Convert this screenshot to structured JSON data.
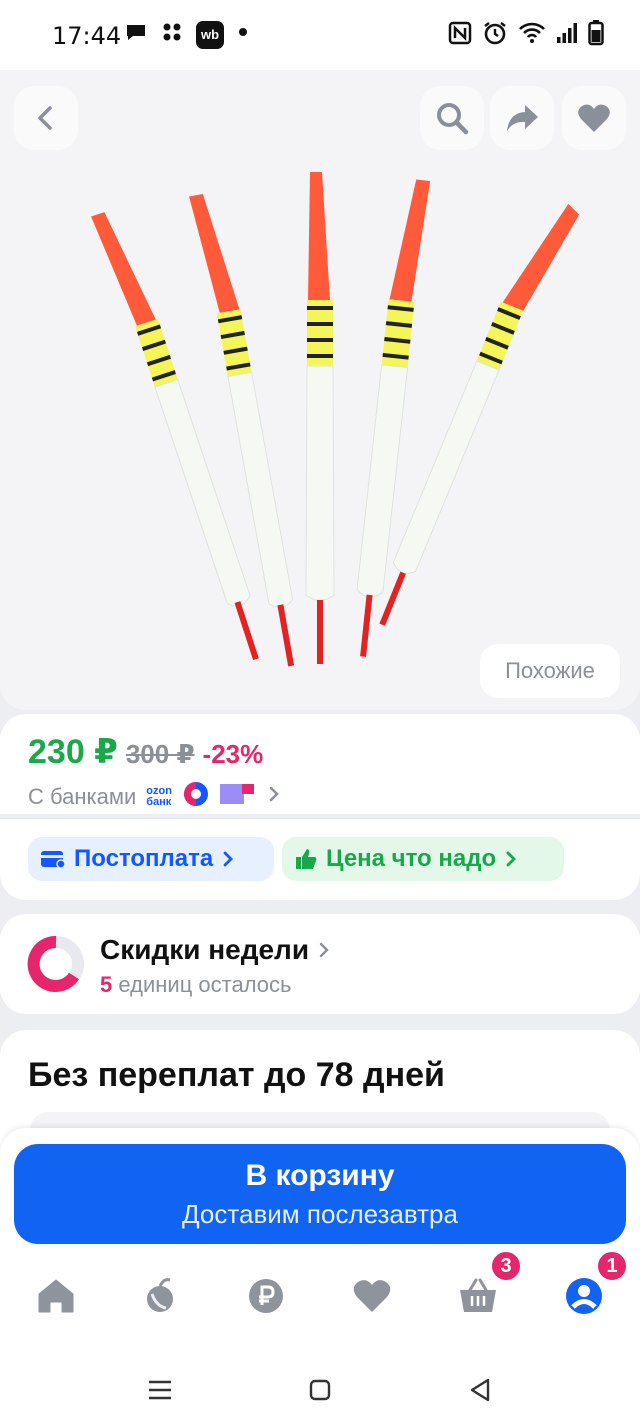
{
  "status_bar": {
    "time": "17:44",
    "left_icons": [
      "chat-bubble-icon",
      "apps-dots-icon",
      "wb-app-icon",
      "notification-dot-icon"
    ],
    "wb_logo_text": "wb",
    "right_icons": [
      "nfc-icon",
      "alarm-icon",
      "wifi-icon",
      "signal-icon",
      "battery-icon"
    ]
  },
  "product": {
    "image_desc_icon": "fishing-floats-image",
    "similar_label": "Похожие"
  },
  "price": {
    "current": "230 ₽",
    "old": "300 ₽",
    "discount": "-23%",
    "banks_label": "С банками",
    "ozon_bank_line1": "ozon",
    "ozon_bank_line2": "банк"
  },
  "payment_chips": {
    "postpay_label": "Постоплата",
    "price_label": "Цена что надо"
  },
  "weekly_discounts": {
    "title": "Скидки недели",
    "count": "5",
    "remaining_text": "единиц осталось"
  },
  "installment": {
    "title": "Без переплат до 78 дней"
  },
  "cart_button": {
    "title": "В корзину",
    "subtitle": "Доставим послезавтра"
  },
  "bottom_nav": {
    "items": [
      "home-icon",
      "catalog-icon",
      "ruble-icon",
      "favorites-icon",
      "cart-icon",
      "profile-icon"
    ],
    "cart_badge": "3",
    "profile_badge": "1"
  },
  "colors": {
    "accent_blue": "#1164f2",
    "price_green": "#1ba84a",
    "discount_pink": "#e5266d",
    "muted_gray": "#8a8f99"
  }
}
